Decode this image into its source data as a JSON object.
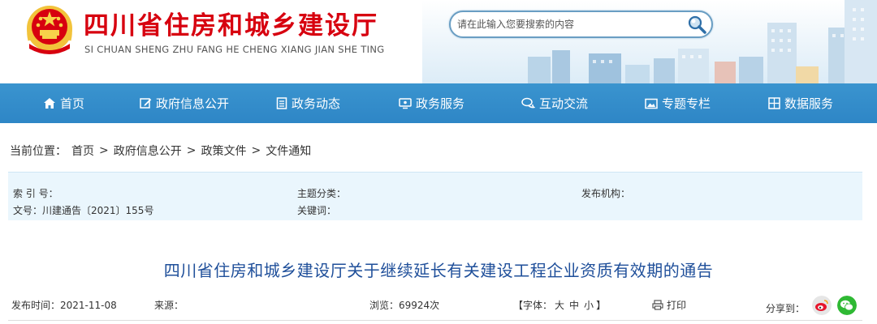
{
  "header": {
    "title": "四川省住房和城乡建设厅",
    "subtitle": "SI CHUAN SHENG ZHU FANG HE CHENG XIANG JIAN SHE TING",
    "search_placeholder": "请在此输入您要搜索的内容"
  },
  "nav": {
    "items": [
      {
        "label": "首页",
        "icon": "home-icon"
      },
      {
        "label": "政府信息公开",
        "icon": "edit-icon"
      },
      {
        "label": "政务动态",
        "icon": "document-icon"
      },
      {
        "label": "政务服务",
        "icon": "monitor-icon"
      },
      {
        "label": "互动交流",
        "icon": "chat-icon"
      },
      {
        "label": "专题专栏",
        "icon": "image-icon"
      },
      {
        "label": "数据服务",
        "icon": "grid-icon"
      }
    ]
  },
  "breadcrumb": {
    "prefix": "当前位置：",
    "items": [
      "首页",
      "政府信息公开",
      "政策文件",
      "文件通知"
    ],
    "separator": ">"
  },
  "meta": {
    "index_label": "索 引 号：",
    "topic_label": "主题分类：",
    "publisher_label": "发布机构：",
    "doc_no_label": "文号：川建通告〔2021〕155号",
    "keywords_label": "关键词："
  },
  "article": {
    "title": "四川省住房和城乡建设厅关于继续延长有关建设工程企业资质有效期的通告"
  },
  "info": {
    "publish_date": "发布时间：2021-11-08",
    "source": "来源：",
    "views": "浏览：69924次",
    "font_prefix": "【字体：",
    "font_large": "大",
    "font_medium": "中",
    "font_small": "小",
    "font_suffix": "】",
    "print": "打印",
    "share": "分享到："
  },
  "colors": {
    "title_red": "#d7000f",
    "nav_blue": "#3a94cf",
    "article_title": "#1f4f9a",
    "meta_bg": "#eaf6fd"
  }
}
